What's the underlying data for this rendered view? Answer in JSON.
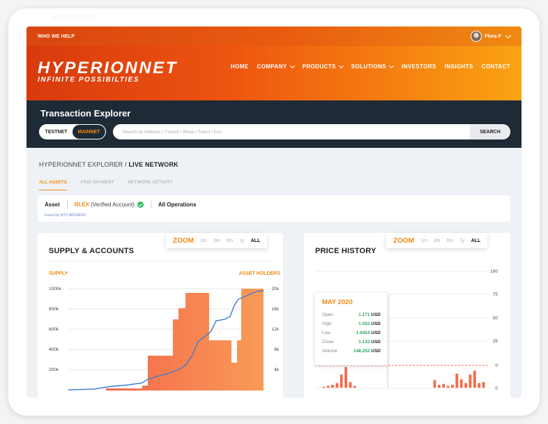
{
  "topbar": {
    "who_we_help": "WHO WE HELP",
    "user_name": "Flora P"
  },
  "brand": {
    "title": "HYPERIONNET",
    "subtitle": "INFINITE POSSIBILTIES"
  },
  "nav": {
    "items": [
      {
        "label": "HOME",
        "dropdown": false
      },
      {
        "label": "COMPANY",
        "dropdown": true
      },
      {
        "label": "PRODUCTS",
        "dropdown": true
      },
      {
        "label": "SOLUTIONS",
        "dropdown": true
      },
      {
        "label": "INVESTORS",
        "dropdown": false
      },
      {
        "label": "INSIGHTS",
        "dropdown": false
      },
      {
        "label": "CONTACT",
        "dropdown": false
      }
    ]
  },
  "explorer": {
    "title": "Transaction Explorer",
    "testnet": "TESTNET",
    "mainnet": "MAINNET",
    "search_placeholder": "Search by Address / Txhash / Block / Token / Ens",
    "search_button": "SEARCH"
  },
  "breadcrumb": {
    "part1": "HYPERIONNET  EXPLORER / ",
    "part2": "LIVE NETWORK"
  },
  "tabs": [
    "ALL ASSETS",
    "FIND PAYMENT",
    "NETWORK ACTIVITY"
  ],
  "asset": {
    "key": "Asset",
    "code": "RLEX",
    "verified": "(Verified Account)",
    "operations": "All Operations",
    "issued_by": "Issued by MTS BROKERS"
  },
  "zoom": {
    "label": "ZOOM",
    "options": [
      "1m",
      "3m",
      "6m",
      "1y",
      "ALL"
    ],
    "active": "ALL"
  },
  "supply_panel": {
    "title": "SUPPLY & ACCOUNTS",
    "left_label": "SUPPLY",
    "right_label": "ASSET HOLDERS"
  },
  "price_panel": {
    "title": "PRICE HISTORY",
    "tooltip": {
      "title": "MAY 2020",
      "rows": [
        {
          "key": "Open",
          "num": "1.171",
          "unit": "USD"
        },
        {
          "key": "High",
          "num": "1.553",
          "unit": "USD"
        },
        {
          "key": "Low",
          "num": "1.0424",
          "unit": "USD"
        },
        {
          "key": "Close",
          "num": "1.133",
          "unit": "USD"
        },
        {
          "key": "Volume",
          "num": "148,252",
          "unit": "USD"
        }
      ]
    }
  },
  "colors": {
    "accent": "#f08a12",
    "dark": "#1f2a37",
    "positive": "#26a65b",
    "bar": "#f46a4a",
    "line": "#3b7bd8"
  },
  "chart_data": [
    {
      "type": "area",
      "title": "SUPPLY & ACCOUNTS",
      "left_axis": {
        "label": "SUPPLY",
        "ticks": [
          "1000k",
          "800k",
          "600k",
          "400k",
          "200k"
        ],
        "ylim": [
          0,
          1000
        ]
      },
      "right_axis": {
        "label": "ASSET HOLDERS",
        "ticks": [
          "20k",
          "16k",
          "12k",
          "8k",
          "4k"
        ],
        "ylim": [
          0,
          20
        ]
      },
      "series": [
        {
          "name": "SUPPLY",
          "type": "step-area",
          "x": [
            0,
            0.41,
            0.6,
            0.65,
            0.74,
            0.83,
            0.95,
            1.0
          ],
          "values": [
            10,
            340,
            800,
            1000,
            460,
            460,
            1000,
            1000
          ]
        },
        {
          "name": "ASSET HOLDERS",
          "type": "line",
          "x": [
            0,
            0.3,
            0.45,
            0.55,
            0.63,
            0.74,
            0.86,
            1.0
          ],
          "values": [
            0.4,
            0.8,
            2,
            5,
            10,
            14.5,
            17.5,
            19
          ]
        }
      ]
    },
    {
      "type": "bar",
      "title": "PRICE HISTORY",
      "right_axis": {
        "ticks": [
          "100",
          "75",
          "50",
          "25",
          "0",
          "0"
        ],
        "ylim": [
          0,
          100
        ]
      },
      "volume_bars": [
        0,
        1,
        2,
        3,
        5,
        14,
        22,
        6,
        2,
        0,
        0,
        0,
        0,
        0,
        0,
        0,
        0,
        0,
        0,
        0,
        0,
        0,
        0,
        0,
        0,
        0,
        8,
        3,
        4,
        2,
        3,
        15,
        9,
        5,
        14,
        18,
        5,
        6
      ]
    }
  ]
}
